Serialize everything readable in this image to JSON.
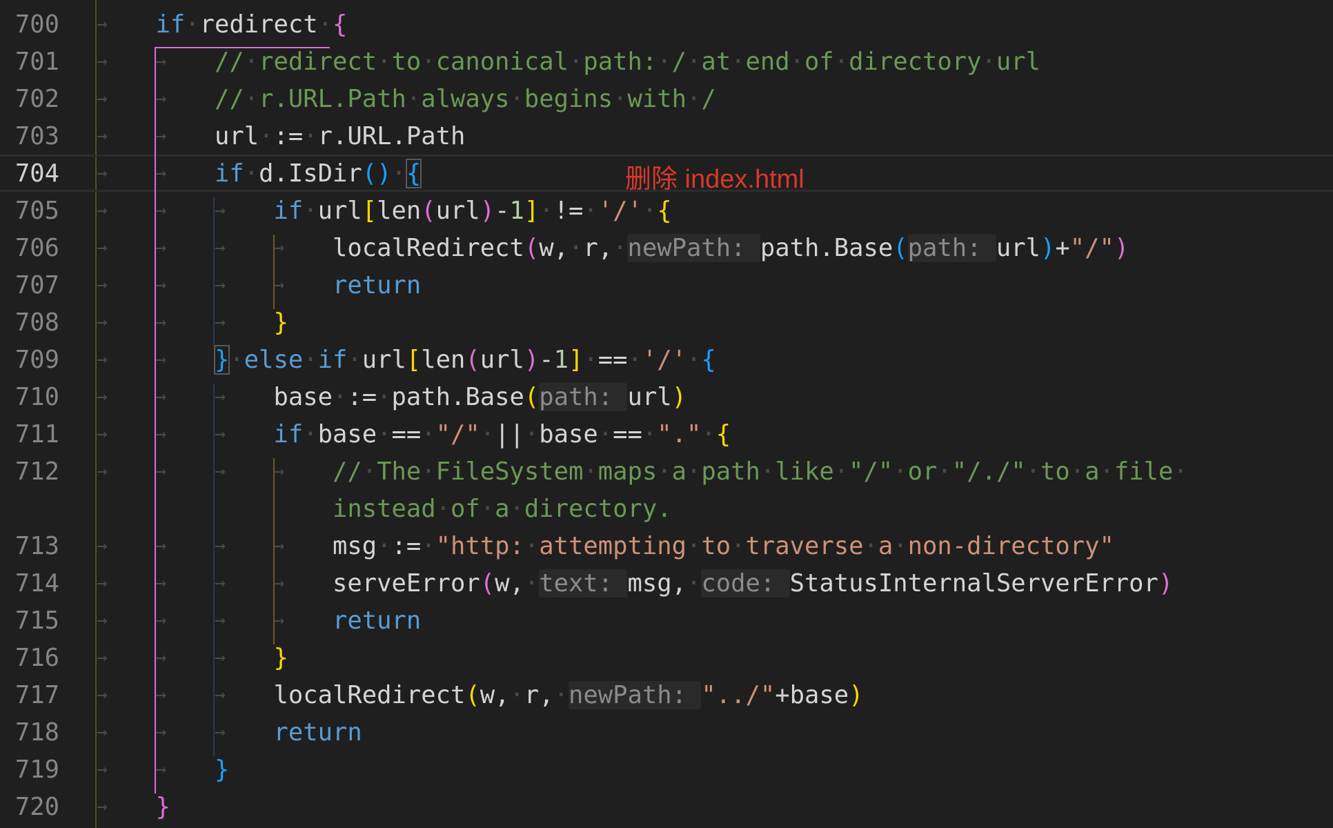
{
  "annotation": "删除 index.html",
  "current_line": "704",
  "lines": [
    {
      "num": "700",
      "indent": 1,
      "tokens": [
        [
          "k",
          "if"
        ],
        [
          "p",
          " redirect "
        ],
        [
          "b1",
          "{"
        ]
      ]
    },
    {
      "num": "701",
      "indent": 2,
      "tokens": [
        [
          "c",
          "// redirect to canonical path: / at end of directory url"
        ]
      ]
    },
    {
      "num": "702",
      "indent": 2,
      "tokens": [
        [
          "c",
          "// r.URL.Path always begins with /"
        ]
      ]
    },
    {
      "num": "703",
      "indent": 2,
      "tokens": [
        [
          "p",
          "url := r.URL.Path"
        ]
      ]
    },
    {
      "num": "704",
      "indent": 2,
      "tokens": [
        [
          "k",
          "if"
        ],
        [
          "p",
          " d.IsDir"
        ],
        [
          "b2",
          "()"
        ],
        [
          "p",
          " "
        ],
        [
          "b2 m",
          "{"
        ]
      ]
    },
    {
      "num": "705",
      "indent": 3,
      "tokens": [
        [
          "k",
          "if"
        ],
        [
          "p",
          " url"
        ],
        [
          "b3",
          "["
        ],
        [
          "p",
          "len"
        ],
        [
          "b1",
          "("
        ],
        [
          "p",
          "url"
        ],
        [
          "b1",
          ")"
        ],
        [
          "p",
          "-"
        ],
        [
          "n",
          "1"
        ],
        [
          "b3",
          "]"
        ],
        [
          "p",
          " != "
        ],
        [
          "s",
          "'/'"
        ],
        [
          "p",
          " "
        ],
        [
          "b3",
          "{"
        ]
      ]
    },
    {
      "num": "706",
      "indent": 4,
      "tokens": [
        [
          "p",
          "localRedirect"
        ],
        [
          "b1",
          "("
        ],
        [
          "p",
          "w, r, "
        ],
        [
          "h",
          "newPath: "
        ],
        [
          "p",
          "path.Base"
        ],
        [
          "b2",
          "("
        ],
        [
          "h",
          "path: "
        ],
        [
          "p",
          "url"
        ],
        [
          "b2",
          ")"
        ],
        [
          "p",
          "+"
        ],
        [
          "s",
          "\"/\""
        ],
        [
          "b1",
          ")"
        ]
      ]
    },
    {
      "num": "707",
      "indent": 4,
      "tokens": [
        [
          "k",
          "return"
        ]
      ]
    },
    {
      "num": "708",
      "indent": 3,
      "tokens": [
        [
          "b3",
          "}"
        ]
      ]
    },
    {
      "num": "709",
      "indent": 2,
      "tokens": [
        [
          "b2 m",
          "}"
        ],
        [
          "p",
          " "
        ],
        [
          "k",
          "else if"
        ],
        [
          "p",
          " url"
        ],
        [
          "b3",
          "["
        ],
        [
          "p",
          "len"
        ],
        [
          "b1",
          "("
        ],
        [
          "p",
          "url"
        ],
        [
          "b1",
          ")"
        ],
        [
          "p",
          "-"
        ],
        [
          "n",
          "1"
        ],
        [
          "b3",
          "]"
        ],
        [
          "p",
          " == "
        ],
        [
          "s",
          "'/'"
        ],
        [
          "p",
          " "
        ],
        [
          "b2",
          "{"
        ]
      ]
    },
    {
      "num": "710",
      "indent": 3,
      "tokens": [
        [
          "p",
          "base := path.Base"
        ],
        [
          "b3",
          "("
        ],
        [
          "h",
          "path: "
        ],
        [
          "p",
          "url"
        ],
        [
          "b3",
          ")"
        ]
      ]
    },
    {
      "num": "711",
      "indent": 3,
      "tokens": [
        [
          "k",
          "if"
        ],
        [
          "p",
          " base == "
        ],
        [
          "s",
          "\"/\""
        ],
        [
          "p",
          " || base == "
        ],
        [
          "s",
          "\".\""
        ],
        [
          "p",
          " "
        ],
        [
          "b3",
          "{"
        ]
      ]
    },
    {
      "num": "712",
      "indent": 4,
      "tokens": [
        [
          "c",
          "// The FileSystem maps a path like \"/\" or \"/./\" to a file "
        ]
      ]
    },
    {
      "num": "",
      "indent": 4,
      "wrap": true,
      "tokens": [
        [
          "c",
          "instead of a directory."
        ]
      ]
    },
    {
      "num": "713",
      "indent": 4,
      "tokens": [
        [
          "p",
          "msg := "
        ],
        [
          "s",
          "\"http: attempting to traverse a non-directory\""
        ]
      ]
    },
    {
      "num": "714",
      "indent": 4,
      "tokens": [
        [
          "p",
          "serveError"
        ],
        [
          "b1",
          "("
        ],
        [
          "p",
          "w, "
        ],
        [
          "h",
          "text: "
        ],
        [
          "p",
          "msg, "
        ],
        [
          "h",
          "code: "
        ],
        [
          "p",
          "StatusInternalServerError"
        ],
        [
          "b1",
          ")"
        ]
      ]
    },
    {
      "num": "715",
      "indent": 4,
      "tokens": [
        [
          "k",
          "return"
        ]
      ]
    },
    {
      "num": "716",
      "indent": 3,
      "tokens": [
        [
          "b3",
          "}"
        ]
      ]
    },
    {
      "num": "717",
      "indent": 3,
      "tokens": [
        [
          "p",
          "localRedirect"
        ],
        [
          "b3",
          "("
        ],
        [
          "p",
          "w, r, "
        ],
        [
          "h",
          "newPath: "
        ],
        [
          "s",
          "\"../\""
        ],
        [
          "p",
          "+base"
        ],
        [
          "b3",
          ")"
        ]
      ]
    },
    {
      "num": "718",
      "indent": 3,
      "tokens": [
        [
          "k",
          "return"
        ]
      ]
    },
    {
      "num": "719",
      "indent": 2,
      "tokens": [
        [
          "b2",
          "}"
        ]
      ]
    },
    {
      "num": "720",
      "indent": 1,
      "tokens": [
        [
          "b1",
          "}"
        ]
      ]
    }
  ]
}
